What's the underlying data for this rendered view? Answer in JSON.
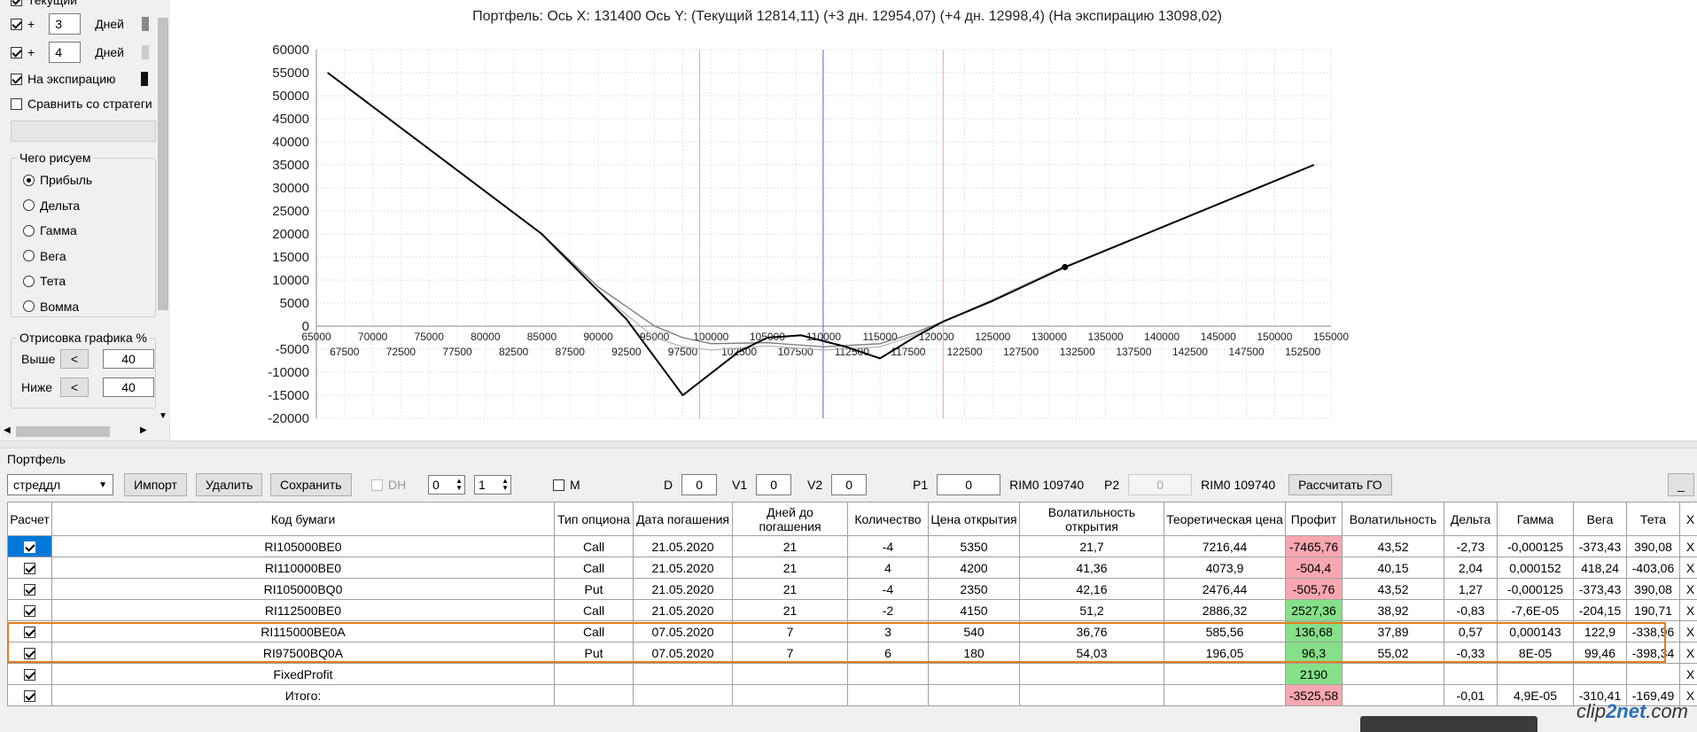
{
  "sidebar": {
    "current_label": "Текущий",
    "plus_rows": [
      {
        "sign": "+",
        "value": "3",
        "unit": "Дней"
      },
      {
        "sign": "+",
        "value": "4",
        "unit": "Дней"
      }
    ],
    "expiry_label": "На экспирацию",
    "compare_label": "Сравнить со стратеги",
    "draw_group_title": "Чего рисуем",
    "draw_options": [
      "Прибыль",
      "Дельта",
      "Гамма",
      "Вега",
      "Тета",
      "Вомма"
    ],
    "draw_selected": "Прибыль",
    "percent_group_title": "Отрисовка графика %",
    "above_label": "Выше",
    "below_label": "Ниже",
    "lt_label": "<",
    "above_value": "40",
    "below_value": "40"
  },
  "chart": {
    "title": "Портфель: Ось X: 131400 Ось Y:  (Текущий 12814,11)  (+3 дн. 12954,07)  (+4 дн. 12998,4)  (На экспирацию 13098,02)"
  },
  "chart_data": {
    "type": "line",
    "xlim": [
      65000,
      155000
    ],
    "ylim": [
      -20000,
      60000
    ],
    "x_ticks_upper": [
      65000,
      70000,
      75000,
      80000,
      85000,
      90000,
      95000,
      100000,
      105000,
      110000,
      115000,
      120000,
      125000,
      130000,
      135000,
      140000,
      145000,
      150000,
      155000
    ],
    "x_ticks_lower": [
      67500,
      72500,
      77500,
      82500,
      87500,
      92500,
      97500,
      102500,
      107500,
      112500,
      117500,
      122500,
      127500,
      132500,
      137500,
      142500,
      147500,
      152500
    ],
    "y_ticks": [
      60000,
      55000,
      50000,
      45000,
      40000,
      35000,
      30000,
      25000,
      20000,
      15000,
      10000,
      5000,
      0,
      -5000,
      -10000,
      -15000,
      -20000
    ],
    "vlines": [
      {
        "x": 99000,
        "color": "#f3a0a8"
      },
      {
        "x": 109950,
        "color": "#5470c8"
      },
      {
        "x": 120600,
        "color": "#f3a0a8"
      }
    ],
    "marker": {
      "x": 131400,
      "y": 12814
    },
    "series": [
      {
        "color": "#000000",
        "points": [
          [
            66000,
            55000
          ],
          [
            85000,
            20000
          ],
          [
            92500,
            1500
          ],
          [
            97500,
            -15000
          ],
          [
            102500,
            -5500
          ],
          [
            105000,
            -2500
          ],
          [
            108000,
            -2000
          ],
          [
            112000,
            -4500
          ],
          [
            115000,
            -7000
          ],
          [
            118000,
            -2500
          ],
          [
            120600,
            1000
          ],
          [
            125000,
            5500
          ],
          [
            131400,
            12814
          ],
          [
            153500,
            35000
          ]
        ]
      },
      {
        "color": "#777777",
        "points": [
          [
            85000,
            20000
          ],
          [
            90000,
            8500
          ],
          [
            95000,
            0
          ],
          [
            97500,
            -2500
          ],
          [
            100000,
            -3800
          ],
          [
            105000,
            -3600
          ],
          [
            110000,
            -4500
          ],
          [
            115000,
            -3800
          ],
          [
            118000,
            -1500
          ],
          [
            120600,
            1000
          ]
        ]
      },
      {
        "color": "#b5b5b5",
        "points": [
          [
            85000,
            20000
          ],
          [
            90000,
            7500
          ],
          [
            95000,
            -2500
          ],
          [
            97500,
            -4500
          ],
          [
            100000,
            -5200
          ],
          [
            105000,
            -4300
          ],
          [
            110000,
            -5200
          ],
          [
            115000,
            -4500
          ],
          [
            118000,
            -2000
          ],
          [
            120600,
            1000
          ],
          [
            125000,
            5800
          ],
          [
            131400,
            13098
          ]
        ]
      }
    ]
  },
  "toolbar": {
    "section_title": "Портфель",
    "strategy": "стреддл",
    "import_label": "Импорт",
    "delete_label": "Удалить",
    "save_label": "Сохранить",
    "dh_label": "DH",
    "spin1": "0",
    "spin2": "1",
    "m_label": "M",
    "d_label": "D",
    "d_value": "0",
    "v1_label": "V1",
    "v1_value": "0",
    "v2_label": "V2",
    "v2_value": "0",
    "p1_label": "P1",
    "p1_value": "0",
    "rim1": "RIM0 109740",
    "p2_label": "P2",
    "p2_value": "0",
    "rim2": "RIM0 109740",
    "go_label": "Рассчитать ГО",
    "minimize_label": "_"
  },
  "table": {
    "headers": [
      "Расчет",
      "Код бумаги",
      "Тип опциона",
      "Дата погашения",
      "Дней до погашения",
      "Количество",
      "Цена открытия",
      "Волатильность открытия",
      "Теоретическая цена",
      "Профит",
      "Волатильность",
      "Дельта",
      "Гамма",
      "Вега",
      "Тета",
      "X"
    ],
    "rows": [
      {
        "code": "RI105000BE0",
        "type": "Call",
        "date": "21.05.2020",
        "days": "21",
        "qty": "-4",
        "price": "5350",
        "vol_open": "21,7",
        "theo": "7216,44",
        "profit": "-7465,76",
        "profit_sign": "neg",
        "vol": "43,52",
        "delta": "-2,73",
        "gamma": "-0,000125",
        "vega": "-373,43",
        "theta": "390,08",
        "x": "X"
      },
      {
        "code": "RI110000BE0",
        "type": "Call",
        "date": "21.05.2020",
        "days": "21",
        "qty": "4",
        "price": "4200",
        "vol_open": "41,36",
        "theo": "4073,9",
        "profit": "-504,4",
        "profit_sign": "neg",
        "vol": "40,15",
        "delta": "2,04",
        "gamma": "0,000152",
        "vega": "418,24",
        "theta": "-403,06",
        "x": "X"
      },
      {
        "code": "RI105000BQ0",
        "type": "Put",
        "date": "21.05.2020",
        "days": "21",
        "qty": "-4",
        "price": "2350",
        "vol_open": "42,16",
        "theo": "2476,44",
        "profit": "-505,76",
        "profit_sign": "neg",
        "vol": "43,52",
        "delta": "1,27",
        "gamma": "-0,000125",
        "vega": "-373,43",
        "theta": "390,08",
        "x": "X"
      },
      {
        "code": "RI112500BE0",
        "type": "Call",
        "date": "21.05.2020",
        "days": "21",
        "qty": "-2",
        "price": "4150",
        "vol_open": "51,2",
        "theo": "2886,32",
        "profit": "2527,36",
        "profit_sign": "pos",
        "vol": "38,92",
        "delta": "-0,83",
        "gamma": "-7,6E-05",
        "vega": "-204,15",
        "theta": "190,71",
        "x": "X"
      },
      {
        "code": "RI115000BE0A",
        "type": "Call",
        "date": "07.05.2020",
        "days": "7",
        "qty": "3",
        "price": "540",
        "vol_open": "36,76",
        "theo": "585,56",
        "profit": "136,68",
        "profit_sign": "pos",
        "vol": "37,89",
        "delta": "0,57",
        "gamma": "0,000143",
        "vega": "122,9",
        "theta": "-338,96",
        "x": "X"
      },
      {
        "code": "RI97500BQ0A",
        "type": "Put",
        "date": "07.05.2020",
        "days": "7",
        "qty": "6",
        "price": "180",
        "vol_open": "54,03",
        "theo": "196,05",
        "profit": "96,3",
        "profit_sign": "pos",
        "vol": "55,02",
        "delta": "-0,33",
        "gamma": "8E-05",
        "vega": "99,46",
        "theta": "-398,34",
        "x": "X"
      },
      {
        "code": "FixedProfit",
        "type": "",
        "date": "",
        "days": "",
        "qty": "",
        "price": "",
        "vol_open": "",
        "theo": "",
        "profit": "2190",
        "profit_sign": "pos",
        "vol": "",
        "delta": "",
        "gamma": "",
        "vega": "",
        "theta": "",
        "x": "X"
      },
      {
        "code": "Итого:",
        "type": "",
        "date": "",
        "days": "",
        "qty": "",
        "price": "",
        "vol_open": "",
        "theo": "",
        "profit": "-3525,58",
        "profit_sign": "neg",
        "vol": "",
        "delta": "-0,01",
        "gamma": "4,9E-05",
        "vega": "-310,41",
        "theta": "-169,49",
        "x": "X"
      }
    ]
  },
  "watermark": {
    "part1": "clip",
    "part2": "2net",
    "part3": ".com"
  }
}
